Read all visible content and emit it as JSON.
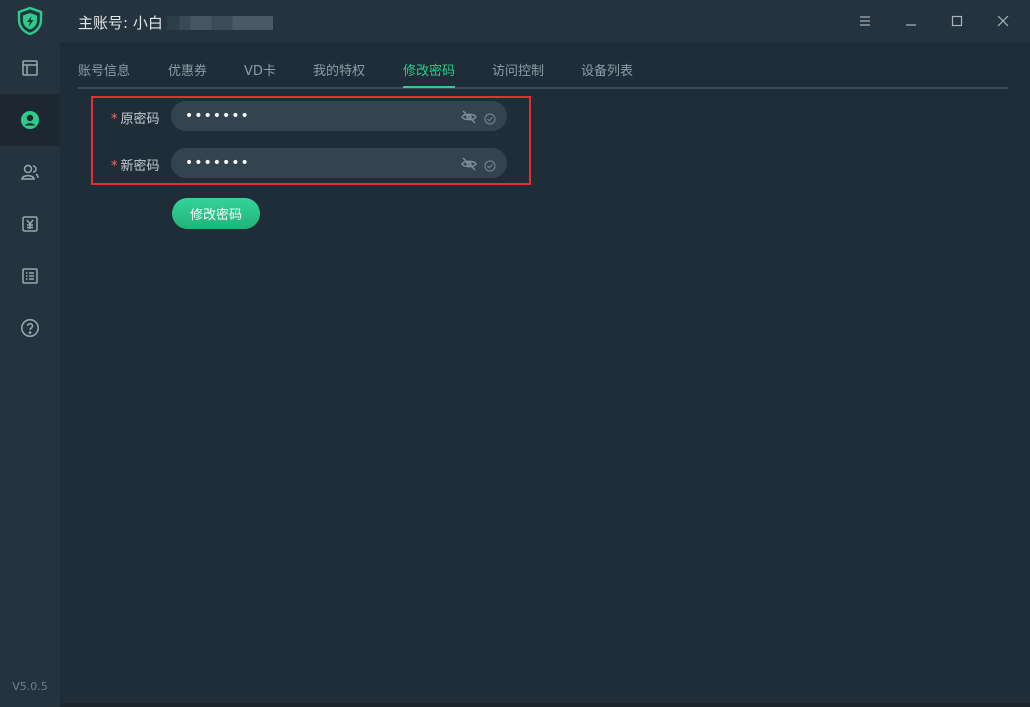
{
  "app": {
    "account_label": "主账号: 小白",
    "version": "V5.0.5",
    "accent_color": "#2ecb8a"
  },
  "sidebar": {
    "items": [
      {
        "icon": "layout-icon"
      },
      {
        "icon": "user-icon",
        "active": true
      },
      {
        "icon": "users-icon"
      },
      {
        "icon": "yuan-icon"
      },
      {
        "icon": "list-icon"
      },
      {
        "icon": "help-icon"
      }
    ]
  },
  "window_controls": [
    "menu-icon",
    "minimize-icon",
    "maximize-icon",
    "close-icon"
  ],
  "tabs": [
    {
      "label": "账号信息"
    },
    {
      "label": "优惠券"
    },
    {
      "label": "VD卡"
    },
    {
      "label": "我的特权"
    },
    {
      "label": "修改密码",
      "active": true
    },
    {
      "label": "访问控制"
    },
    {
      "label": "设备列表"
    }
  ],
  "form": {
    "old_password": {
      "label": "原密码",
      "required": "*",
      "value": "•••••••"
    },
    "new_password": {
      "label": "新密码",
      "required": "*",
      "value": "•••••••"
    },
    "submit_label": "修改密码"
  }
}
